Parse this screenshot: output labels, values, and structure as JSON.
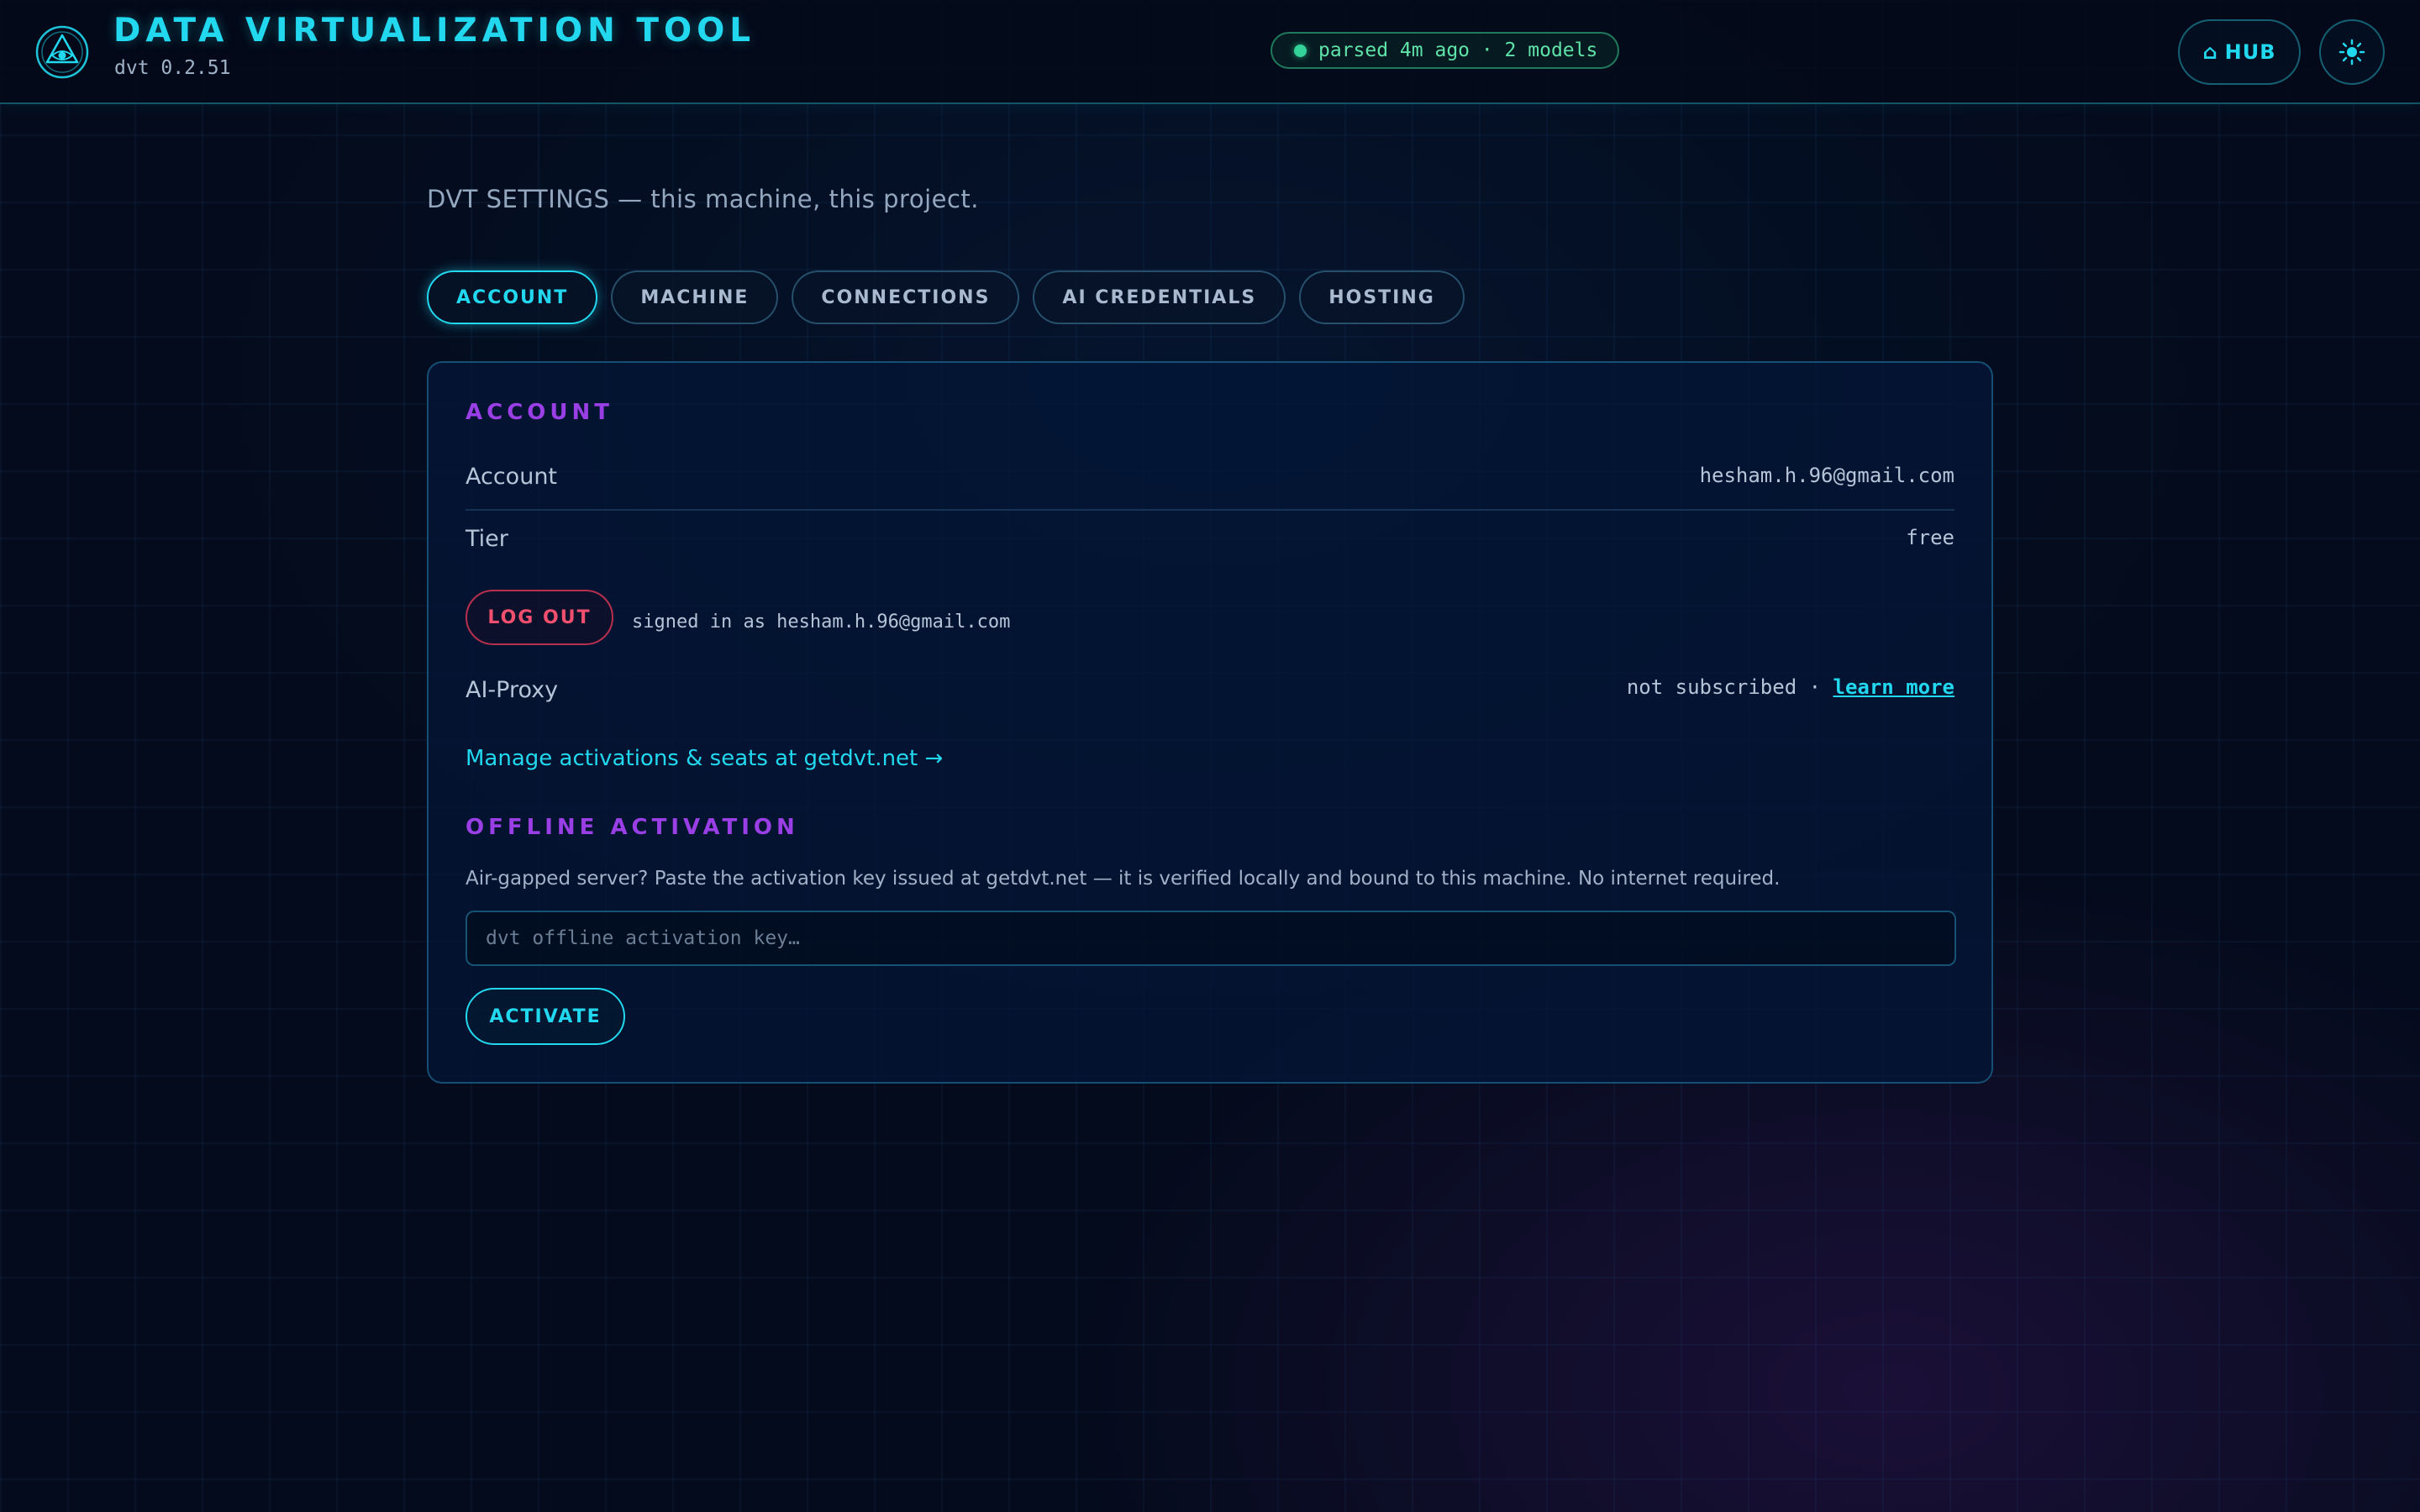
{
  "app": {
    "title": "DATA VIRTUALIZATION TOOL",
    "version": "dvt 0.2.51",
    "logo_icon": "eye-triangle-logo-icon"
  },
  "header": {
    "status": "parsed 4m ago · 2 models",
    "status_color": "#34d399",
    "hub_icon": "⌂",
    "hub_label": "HUB",
    "theme_icon": "sun-icon"
  },
  "page": {
    "title": "DVT SETTINGS — this machine, this project."
  },
  "tabs": [
    {
      "label": "ACCOUNT",
      "active": true
    },
    {
      "label": "MACHINE",
      "active": false
    },
    {
      "label": "CONNECTIONS",
      "active": false
    },
    {
      "label": "AI CREDENTIALS",
      "active": false
    },
    {
      "label": "HOSTING",
      "active": false
    }
  ],
  "account": {
    "section_title": "ACCOUNT",
    "account_label": "Account",
    "account_value": "hesham.h.96@gmail.com",
    "tier_label": "Tier",
    "tier_value": "free",
    "logout_label": "LOG OUT",
    "signed_in_text": "signed in as hesham.h.96@gmail.com",
    "ai_proxy_label": "AI-Proxy",
    "ai_proxy_status": "not subscribed · ",
    "learn_more": "learn more",
    "manage_link": "Manage activations & seats at getdvt.net →"
  },
  "offline": {
    "section_title": "OFFLINE ACTIVATION",
    "description": "Air-gapped server? Paste the activation key issued at getdvt.net — it is verified locally and bound to this machine. No internet required.",
    "input_placeholder": "dvt offline activation key…",
    "input_value": "",
    "activate_label": "ACTIVATE"
  },
  "colors": {
    "accent": "#22d8ee",
    "section_heading": "#9a3fe6",
    "danger": "#f0506e",
    "success": "#34d399",
    "background": "#040b1c"
  }
}
